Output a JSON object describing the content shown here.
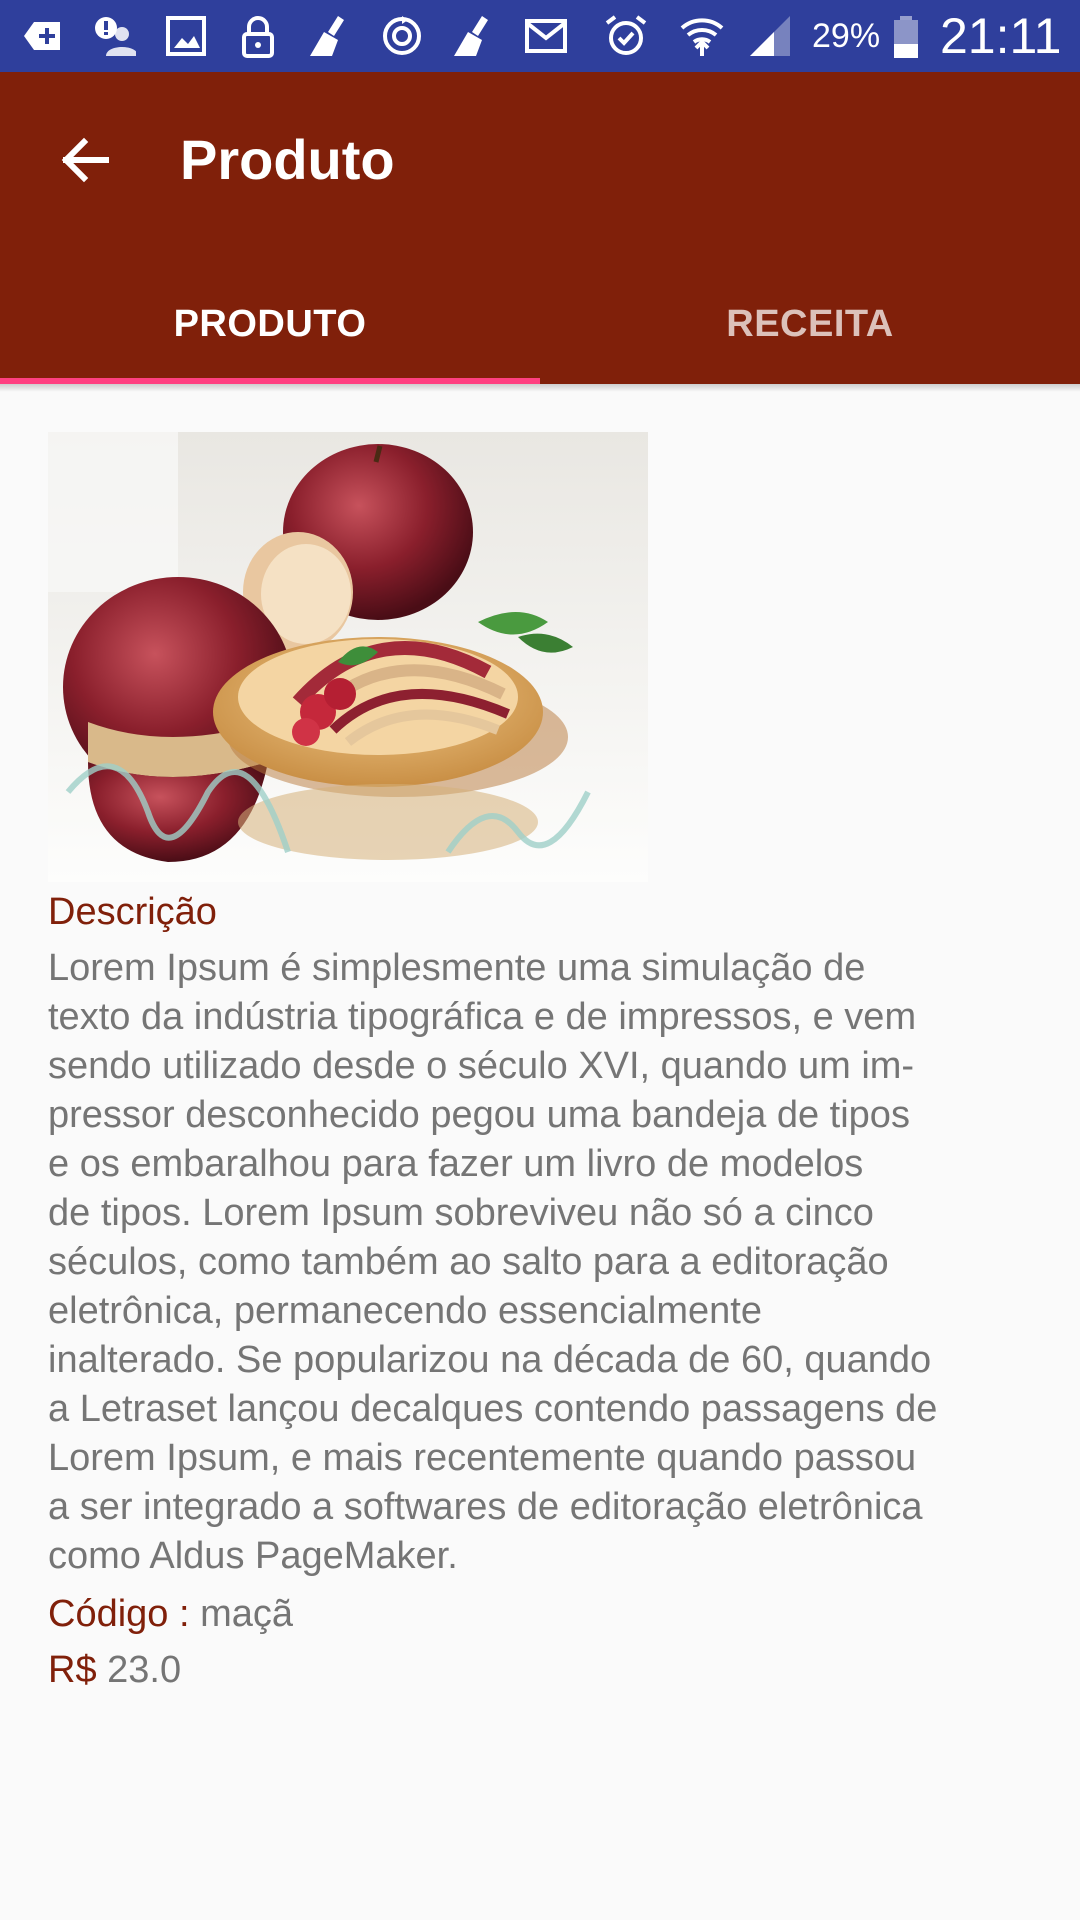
{
  "status_bar": {
    "battery": "29%",
    "time": "21:11",
    "icons": [
      "add-notification-icon",
      "alert-person-icon",
      "image-icon",
      "lock-icon",
      "broom-icon",
      "sync-icon",
      "broom-icon",
      "mail-icon",
      "alarm-icon",
      "wifi-icon",
      "signal-icon",
      "battery-icon"
    ]
  },
  "app_bar": {
    "title": "Produto",
    "back_icon": "arrow-back-icon",
    "color": "#80200a"
  },
  "tabs": [
    {
      "label": "PRODUTO",
      "selected": true
    },
    {
      "label": "RECEITA",
      "selected": false
    }
  ],
  "tab_indicator_color": "#ff4081",
  "product": {
    "image": "apple-tart-photo",
    "description_label": "Descrição",
    "description_lines": [
      "Lorem Ipsum é simplesmente uma simulação de",
      "texto da indústria tipográfica e de impressos, e vem",
      "sendo utilizado desde o século XVI, quando um im-",
      "pressor desconhecido pegou uma bandeja de tipos",
      "e os embaralhou para fazer um livro de modelos",
      "de tipos. Lorem Ipsum sobreviveu não só a cinco",
      "séculos, como também ao salto para a editoração",
      "eletrônica, permanecendo essencialmente",
      "inalterado. Se popularizou na década de 60, quando",
      "a Letraset lançou decalques contendo passagens de",
      "Lorem Ipsum, e mais recentemente quando passou",
      "a ser integrado a softwares de editoração eletrônica",
      "como Aldus PageMaker."
    ],
    "code_label": "Código :",
    "code_value": "maçã",
    "price_label": "R$",
    "price_value": "23.0"
  }
}
